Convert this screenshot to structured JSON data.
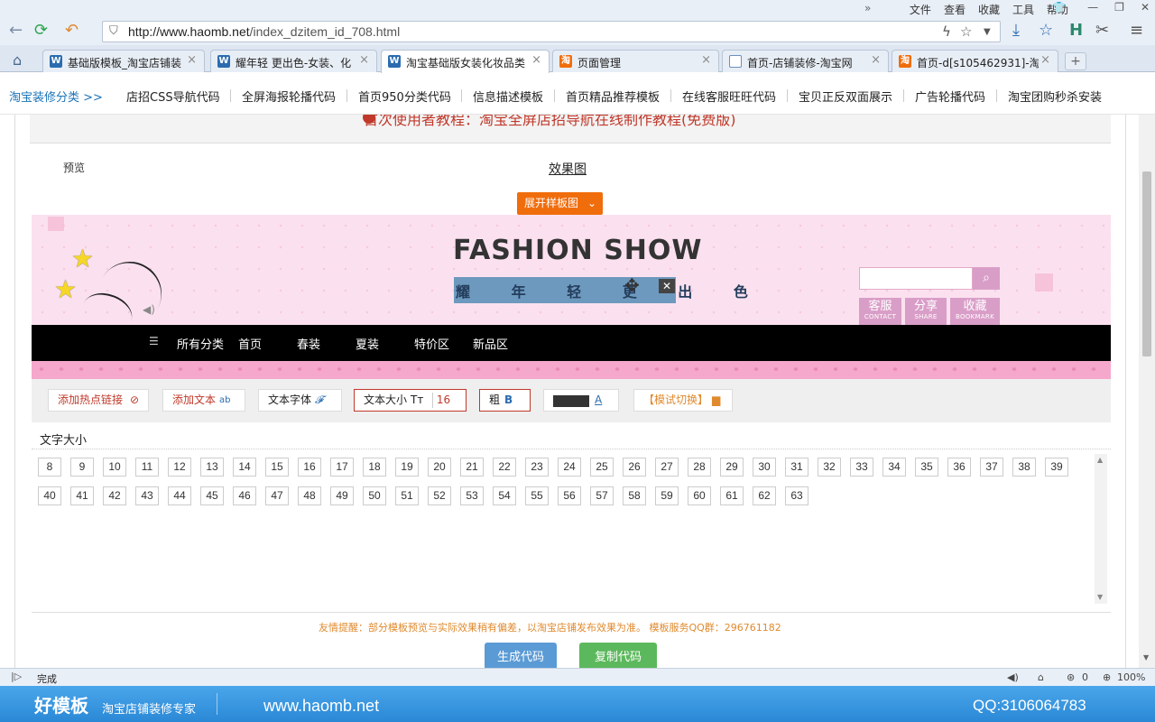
{
  "browser": {
    "menu": [
      "文件",
      "查看",
      "收藏",
      "工具",
      "帮助"
    ],
    "url_host": "http://www.haomb.net",
    "url_path": "/index_dzitem_id_708.html",
    "tabs": [
      {
        "label": "基础版模板_淘宝店铺装",
        "fav": "W",
        "fav_color": "#2b6cb0"
      },
      {
        "label": "耀年轻 更出色-女装、化",
        "fav": "W",
        "fav_color": "#2b6cb0"
      },
      {
        "label": "淘宝基础版女装化妆品类",
        "fav": "W",
        "fav_color": "#2b6cb0"
      },
      {
        "label": "页面管理",
        "fav": "淘",
        "fav_color": "#f06d0c"
      },
      {
        "label": "首页-店铺装修-淘宝网",
        "fav": "",
        "fav_color": "#ffffff"
      },
      {
        "label": "首页-d[s105462931]-淘",
        "fav": "淘",
        "fav_color": "#f06d0c"
      }
    ]
  },
  "site_nav": {
    "brand": "淘宝装修分类 >>",
    "links": [
      "店招CSS导航代码",
      "全屏海报轮播代码",
      "首页950分类代码",
      "信息描述模板",
      "首页精品推荐模板",
      "在线客服旺旺代码",
      "宝贝正反双面展示",
      "广告轮播代码",
      "淘宝团购秒杀安装"
    ]
  },
  "content": {
    "notice": "首次使用者教程：淘宝全屏店招导航在线制作教程(免费版)",
    "preview_label": "预览",
    "effect_title": "效果图",
    "expand_btn": "展开样板图",
    "banner": {
      "title": "FASHION SHOW",
      "subtitle": "耀 年 轻  更 出 色",
      "btns": [
        {
          "t1": "客服",
          "t2": "CONTACT"
        },
        {
          "t1": "分享",
          "t2": "SHARE"
        },
        {
          "t1": "收藏",
          "t2": "BOOKMARK"
        }
      ]
    },
    "nav_items": [
      "所有分类",
      "首页",
      "春装",
      "夏装",
      "特价区",
      "新品区"
    ],
    "toolbar": {
      "add_hotlink": "添加热点链接",
      "add_text": "添加文本",
      "text_font": "文本字体",
      "text_size": "文本大小",
      "text_size_value": "16",
      "bold": "粗",
      "mode_switch": "【模试切换】"
    },
    "font_size_title": "文字大小",
    "sizes": [
      "8",
      "9",
      "10",
      "11",
      "12",
      "13",
      "14",
      "15",
      "16",
      "17",
      "18",
      "19",
      "20",
      "21",
      "22",
      "23",
      "24",
      "25",
      "26",
      "27",
      "28",
      "29",
      "30",
      "31",
      "32",
      "33",
      "34",
      "35",
      "36",
      "37",
      "38",
      "39",
      "40",
      "41",
      "42",
      "43",
      "44",
      "45",
      "46",
      "47",
      "48",
      "49",
      "50",
      "51",
      "52",
      "53",
      "54",
      "55",
      "56",
      "57",
      "58",
      "59",
      "60",
      "61",
      "62",
      "63"
    ],
    "tip": "友情提醒：部分模板预览与实际效果稍有偏差，以淘宝店铺发布效果为准。    模板服务QQ群：296761182",
    "generate_btn": "生成代码",
    "copy_btn": "复制代码"
  },
  "status": {
    "done": "完成",
    "count": "0",
    "zoom": "100%"
  },
  "watermark": {
    "logo": "好模板",
    "slogan": "淘宝店铺装修专家",
    "site": "www.haomb.net",
    "qq": "QQ:3106064783"
  },
  "colors": {
    "accent_orange": "#f06d0c",
    "banner_pink": "#fbe1ef",
    "button_blue": "#5b9bd5",
    "button_green": "#5cb85c"
  }
}
